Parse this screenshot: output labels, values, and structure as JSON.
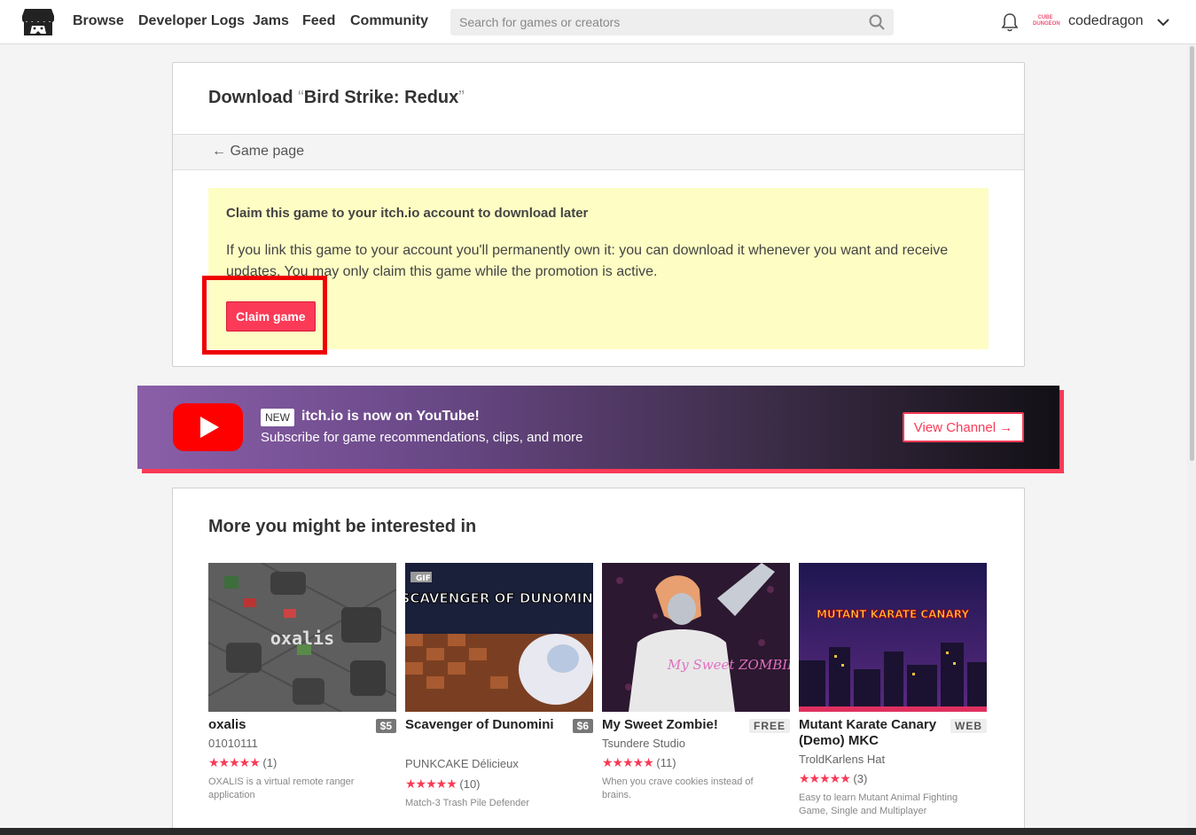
{
  "header": {
    "nav": [
      "Browse",
      "Developer Logs",
      "Jams",
      "Feed",
      "Community"
    ],
    "search_placeholder": "Search for games or creators",
    "username": "codedragon",
    "avatar_text": "CUBE DUNGEON"
  },
  "download": {
    "title_prefix": "Download ",
    "open_quote": "“",
    "game_name": "Bird Strike: Redux",
    "close_quote": "”",
    "back_link": "← Game page"
  },
  "claim": {
    "title": "Claim this game to your itch.io account to download later",
    "text": "If you link this game to your account you'll permanently own it: you can download it whenever you want and receive updates. You may only claim this game while the promotion is active.",
    "button": "Claim game"
  },
  "youtube": {
    "badge": "NEW",
    "title": "itch.io is now on YouTube!",
    "subtitle": "Subscribe for game recommendations, clips, and more",
    "button": "View Channel →"
  },
  "recommendations": {
    "heading": "More you might be interested in",
    "games": [
      {
        "title": "oxalis",
        "price": "$5",
        "author": "01010111",
        "stars": "★★★★★",
        "count": "(1)",
        "desc": "OXALIS is a virtual remote ranger application",
        "thumb_text": "oxalis"
      },
      {
        "title": "Scavenger of Dunomini",
        "price": "$6",
        "author": "PUNKCAKE Délicieux",
        "stars": "★★★★★",
        "count": "(10)",
        "desc": "Match-3 Trash Pile Defender",
        "thumb_text": "SCAVENGER OF DUNOMINI",
        "thumb_badge": "GIF"
      },
      {
        "title": "My Sweet Zombie!",
        "price": "FREE",
        "author": "Tsundere Studio",
        "stars": "★★★★★",
        "count": "(11)",
        "desc": "When you crave cookies instead of brains.",
        "thumb_text": "My Sweet ZOMBIE!"
      },
      {
        "title": "Mutant Karate Canary (Demo) MKC",
        "price": "WEB",
        "author": "TroldKarlens Hat",
        "stars": "★★★★★",
        "count": "(3)",
        "desc": "Easy to learn Mutant Animal Fighting Game, Single and Multiplayer",
        "thumb_text": "MUTANT KARATE CANARY"
      }
    ]
  }
}
